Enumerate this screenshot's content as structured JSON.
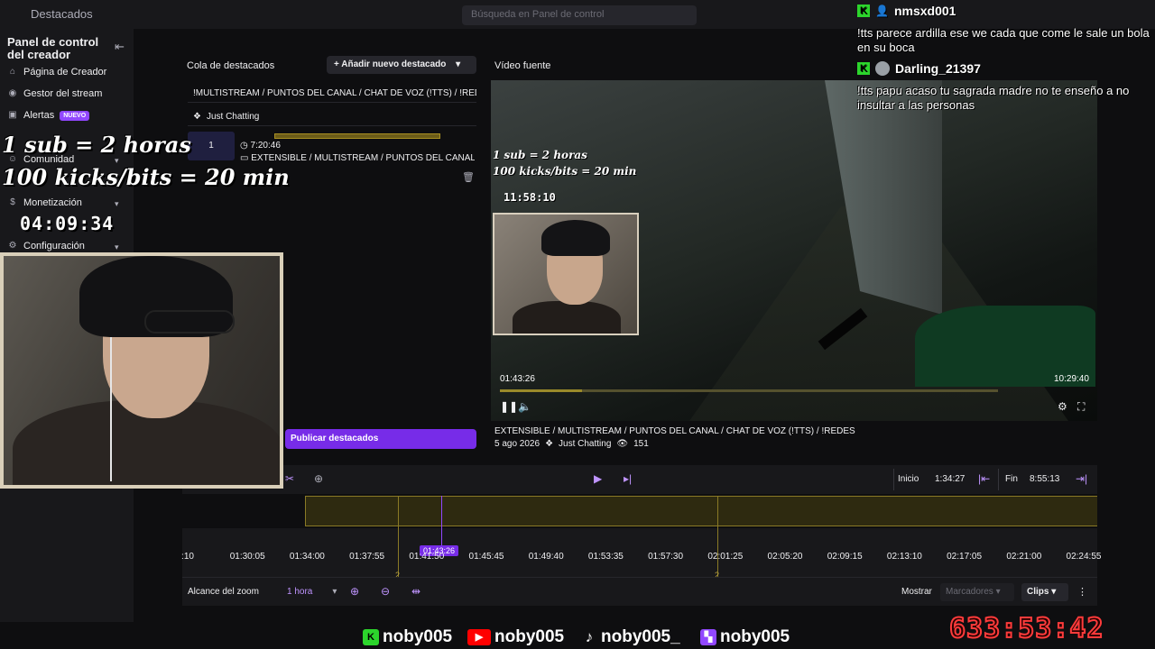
{
  "topbar": {
    "title": "Destacados",
    "search_placeholder": "Búsqueda en Panel de control"
  },
  "sidebar": {
    "heading": "Panel de control del creador",
    "collapse_icon": "arrow-left-collapse-icon",
    "items": [
      {
        "label": "Página de Creador",
        "icon": "home-icon"
      },
      {
        "label": "Gestor del stream",
        "icon": "broadcast-icon"
      },
      {
        "label": "Alertas",
        "icon": "alert-icon",
        "badge": "NUEVO"
      },
      {
        "label": "Comunidad",
        "icon": "community-icon"
      },
      {
        "label": "Monetización",
        "icon": "money-icon"
      },
      {
        "label": "Configuración",
        "icon": "gear-icon"
      }
    ]
  },
  "queue": {
    "title": "Cola de destacados",
    "add_button": "Añadir nuevo destacado",
    "stream_title": "!MULTISTREAM / PUNTOS DEL CANAL / CHAT DE VOZ (!TTS) / !REDES",
    "category": "Just Chatting",
    "clip": {
      "index": "1",
      "duration": "7:20:46",
      "title": "EXTENSIBLE / MULTISTREAM / PUNTOS DEL CANAL / CHAT DE VOZ (!TTS) / !REDES"
    },
    "publish_button": "Publicar destacados"
  },
  "video": {
    "title": "Vídeo fuente",
    "current_time": "01:43:26",
    "end_time": "10:29:40",
    "progress": 0.164,
    "overlay_line1": "1 sub = 2 horas",
    "overlay_line2": "100 kicks/bits = 20 min",
    "overlay_timer": "11:58:10",
    "stream_title": "EXTENSIBLE / MULTISTREAM / PUNTOS DEL CANAL / CHAT DE VOZ (!TTS) / !REDES",
    "date": "5 ago 2026",
    "category": "Just Chatting",
    "views": "151"
  },
  "timeline": {
    "inicio_label": "Inicio",
    "inicio_value": "1:34:27",
    "fin_label": "Fin",
    "fin_value": "8:55:13",
    "playhead": "01:43:26",
    "ticks": [
      ":10",
      "01:30:05",
      "01:34:00",
      "01:37:55",
      "01:41:50",
      "01:45:45",
      "01:49:40",
      "01:53:35",
      "01:57:30",
      "02:01:25",
      "02:05:20",
      "02:09:15",
      "02:13:10",
      "02:17:05",
      "02:21:00",
      "02:24:55"
    ],
    "marker_label_1": "2",
    "marker_label_2": "2",
    "zoom_label": "Alcance del zoom",
    "zoom_value": "1 hora",
    "show_label": "Mostrar",
    "markers_select": "Marcadores",
    "clips_select": "Clips"
  },
  "overlay": {
    "line1": "1 sub = 2 horas",
    "line2": "100 kicks/bits = 20 min",
    "timer": "04:09:34"
  },
  "chat": [
    {
      "user": "nmsxd001",
      "message": "!tts parece ardilla ese we cada que come le sale un bola en su boca"
    },
    {
      "user": "Darling_21397",
      "message": "!tts papu acaso tu sagrada madre no te enseño a no insultar a las personas"
    }
  ],
  "socials": [
    {
      "platform": "kick",
      "handle": "noby005",
      "color": "#2cd52c"
    },
    {
      "platform": "youtube",
      "handle": "noby005",
      "color": "#ff0000"
    },
    {
      "platform": "tiktok",
      "handle": "noby005_",
      "color": "#ffffff"
    },
    {
      "platform": "twitch",
      "handle": "noby005",
      "color": "#9147ff"
    }
  ],
  "big_timer": "633:53:42"
}
